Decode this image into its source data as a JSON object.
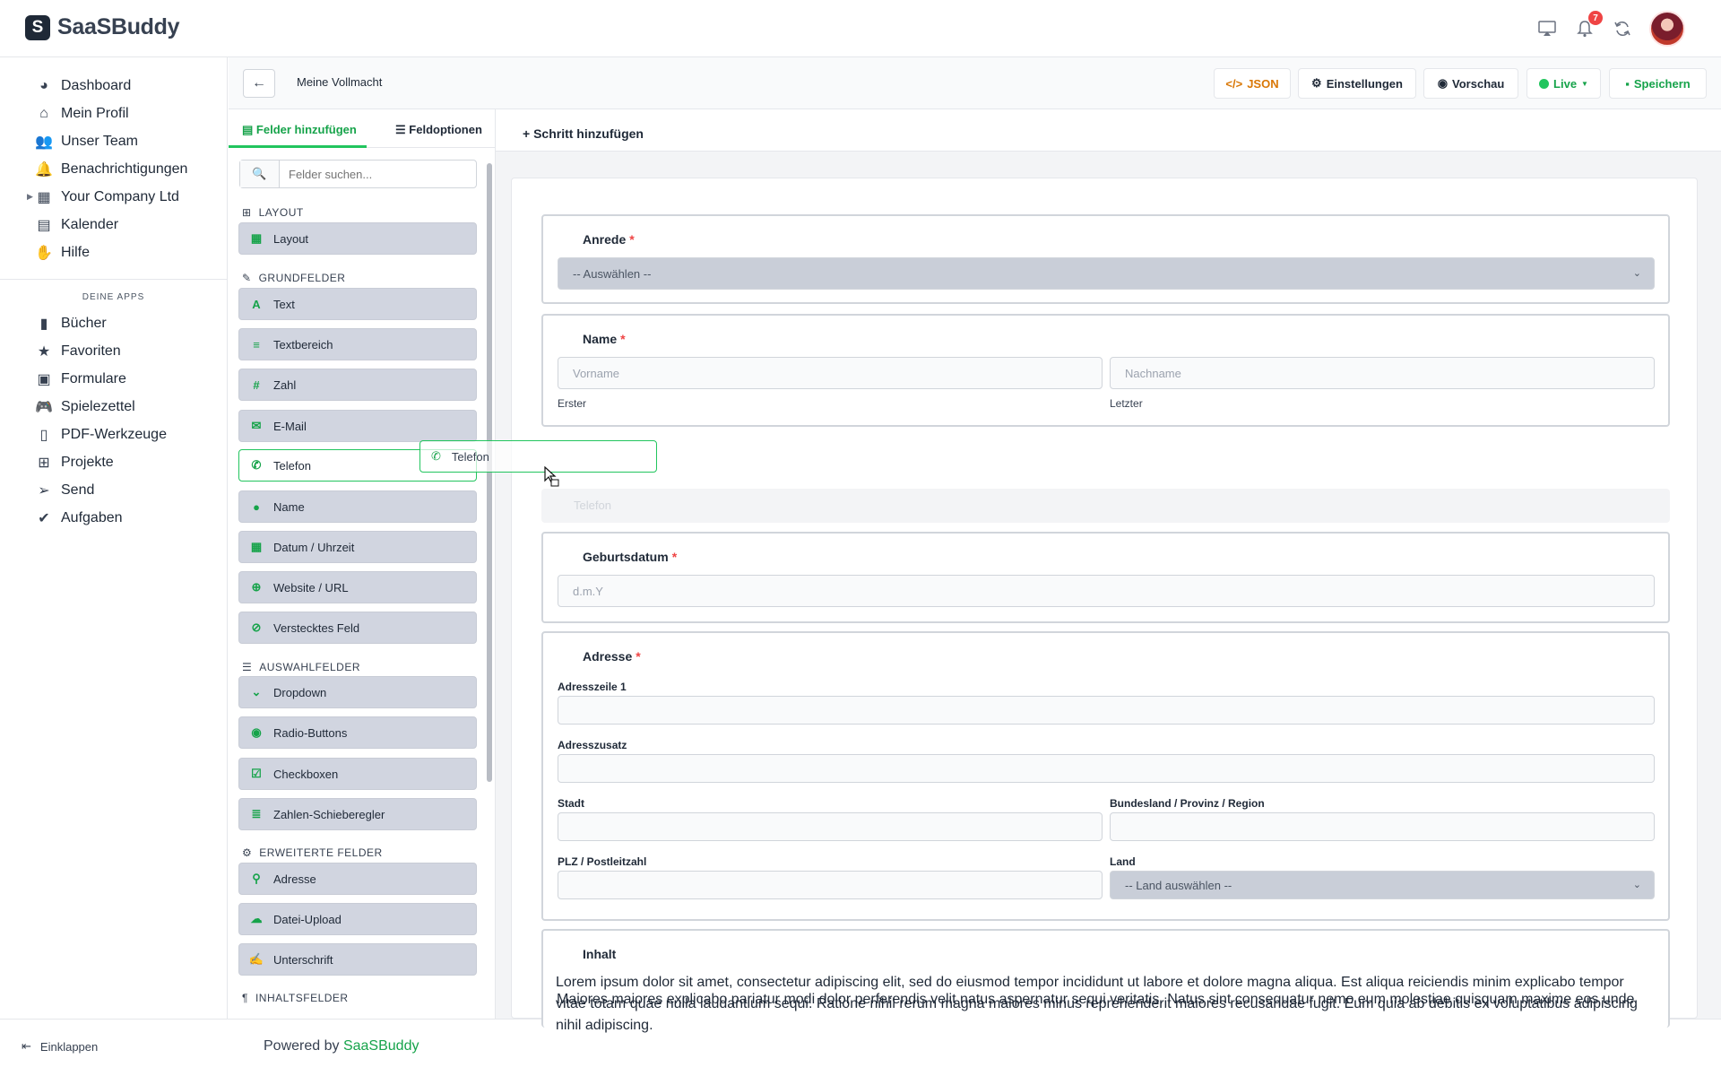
{
  "app": {
    "name": "SaaSBuddy",
    "notification_count": "7"
  },
  "sidebar": {
    "items": [
      {
        "label": "Dashboard",
        "icon": "chart-pie-icon"
      },
      {
        "label": "Mein Profil",
        "icon": "house-user-icon"
      },
      {
        "label": "Unser Team",
        "icon": "users-icon"
      },
      {
        "label": "Benachrichtigungen",
        "icon": "bell-icon"
      },
      {
        "label": "Your Company Ltd",
        "icon": "building-icon"
      },
      {
        "label": "Kalender",
        "icon": "calendar-icon"
      },
      {
        "label": "Hilfe",
        "icon": "hands-helping-icon"
      }
    ],
    "apps_title": "DEINE APPS",
    "apps": [
      {
        "label": "Bücher",
        "icon": "book-icon"
      },
      {
        "label": "Favoriten",
        "icon": "star-icon"
      },
      {
        "label": "Formulare",
        "icon": "form-icon"
      },
      {
        "label": "Spielezettel",
        "icon": "gamepad-icon"
      },
      {
        "label": "PDF-Werkzeuge",
        "icon": "file-pdf-icon"
      },
      {
        "label": "Projekte",
        "icon": "sitemap-icon"
      },
      {
        "label": "Send",
        "icon": "paper-plane-icon"
      },
      {
        "label": "Aufgaben",
        "icon": "check-double-icon"
      }
    ],
    "collapse_label": "Einklappen"
  },
  "footer": {
    "powered_prefix": "Powered by",
    "powered_brand": "SaaSBuddy"
  },
  "editor": {
    "title": "Meine Vollmacht",
    "buttons": {
      "json": "JSON",
      "settings": "Einstellungen",
      "preview": "Vorschau",
      "live": "Live",
      "save": "Speichern"
    },
    "colors": {
      "accent": "#16a34a",
      "json": "#d97706",
      "required": "#ef4444"
    }
  },
  "left_panel": {
    "tabs": {
      "add_fields": "Felder hinzufügen",
      "field_options": "Feldoptionen"
    },
    "search_placeholder": "Felder suchen...",
    "sections": {
      "layout": "LAYOUT",
      "basic": "GRUNDFELDER",
      "choice": "AUSWAHLFELDER",
      "advanced": "ERWEITERTE FELDER",
      "content": "INHALTSFELDER"
    },
    "fields": {
      "layout": "Layout",
      "text": "Text",
      "textarea": "Textbereich",
      "number": "Zahl",
      "email": "E-Mail",
      "phone": "Telefon",
      "name": "Name",
      "datetime": "Datum / Uhrzeit",
      "url": "Website / URL",
      "hidden": "Verstecktes Feld",
      "dropdown": "Dropdown",
      "radio": "Radio-Buttons",
      "checkbox": "Checkboxen",
      "slider": "Zahlen-Schieberegler",
      "address": "Adresse",
      "upload": "Datei-Upload",
      "signature": "Unterschrift"
    }
  },
  "canvas": {
    "add_step": "Schritt hinzufügen",
    "anrede": {
      "label": "Anrede",
      "placeholder": "-- Auswählen --"
    },
    "name": {
      "label": "Name",
      "first_placeholder": "Vorname",
      "last_placeholder": "Nachname",
      "first_sub": "Erster",
      "last_sub": "Letzter"
    },
    "dropzone_text": "Telefon",
    "birthdate": {
      "label": "Geburtsdatum",
      "placeholder": "d.m.Y"
    },
    "address": {
      "label": "Adresse",
      "line1": "Adresszeile 1",
      "line2": "Adresszusatz",
      "city": "Stadt",
      "state": "Bundesland / Provinz / Region",
      "zip": "PLZ / Postleitzahl",
      "country": "Land",
      "country_placeholder": "-- Land auswählen --"
    },
    "content": {
      "label": "Inhalt",
      "para1": "Lorem ipsum dolor sit amet, consectetur adipiscing elit, sed do eiusmod tempor incididunt ut labore et dolore magna aliqua. Est aliqua reiciendis minim explicabo tempor vitae totam quae nulla laudantium sequi. Ratione nihil rerum magna maiores minus reprehenderit maiores recusandae fugit. Eum quia ab debitis ex voluptatibus adipiscing nihil adipiscing.",
      "para2": "Maiores maiores explicabo pariatur modi dolor perferendis velit natus aspernatur sequi veritatis. Natus sint consequatur nemo eum molestiae quisquam maxime eos unde"
    }
  },
  "drag": {
    "label": "Telefon"
  }
}
